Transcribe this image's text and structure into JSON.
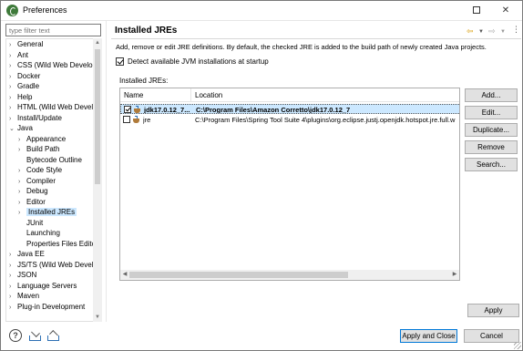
{
  "window": {
    "title": "Preferences",
    "maximize_icon": "maximize-icon",
    "close_label": "✕"
  },
  "filter": {
    "placeholder": "type filter text"
  },
  "nav": {
    "items": [
      {
        "label": "General",
        "chev": ">",
        "depth": 0
      },
      {
        "label": "Ant",
        "chev": ">",
        "depth": 0
      },
      {
        "label": "CSS (Wild Web Developer)",
        "chev": ">",
        "depth": 0
      },
      {
        "label": "Docker",
        "chev": ">",
        "depth": 0
      },
      {
        "label": "Gradle",
        "chev": ">",
        "depth": 0
      },
      {
        "label": "Help",
        "chev": ">",
        "depth": 0
      },
      {
        "label": "HTML (Wild Web Developer)",
        "chev": ">",
        "depth": 0
      },
      {
        "label": "Install/Update",
        "chev": ">",
        "depth": 0
      },
      {
        "label": "Java",
        "chev": "v",
        "depth": 0
      },
      {
        "label": "Appearance",
        "chev": ">",
        "depth": 1
      },
      {
        "label": "Build Path",
        "chev": ">",
        "depth": 1
      },
      {
        "label": "Bytecode Outline",
        "chev": "",
        "depth": 1
      },
      {
        "label": "Code Style",
        "chev": ">",
        "depth": 1
      },
      {
        "label": "Compiler",
        "chev": ">",
        "depth": 1
      },
      {
        "label": "Debug",
        "chev": ">",
        "depth": 1
      },
      {
        "label": "Editor",
        "chev": ">",
        "depth": 1
      },
      {
        "label": "Installed JREs",
        "chev": ">",
        "depth": 1,
        "selected": true
      },
      {
        "label": "JUnit",
        "chev": "",
        "depth": 1
      },
      {
        "label": "Launching",
        "chev": "",
        "depth": 1
      },
      {
        "label": "Properties Files Editor",
        "chev": "",
        "depth": 1
      },
      {
        "label": "Java EE",
        "chev": ">",
        "depth": 0
      },
      {
        "label": "JS/TS (Wild Web Developer)",
        "chev": ">",
        "depth": 0
      },
      {
        "label": "JSON",
        "chev": ">",
        "depth": 0
      },
      {
        "label": "Language Servers",
        "chev": ">",
        "depth": 0
      },
      {
        "label": "Maven",
        "chev": ">",
        "depth": 0
      },
      {
        "label": "Plug-in Development",
        "chev": ">",
        "depth": 0
      }
    ]
  },
  "page": {
    "title": "Installed JREs",
    "description": "Add, remove or edit JRE definitions. By default, the checked JRE is added to the build path of newly created Java projects.",
    "detect_label": "Detect available JVM installations at startup",
    "detect_checked": true,
    "jre_list_label": "Installed JREs:",
    "columns": [
      "Name",
      "Location"
    ],
    "rows": [
      {
        "name": "jdk17.0.12_7...",
        "location": "C:\\Program Files\\Amazon Corretto\\jdk17.0.12_7",
        "checked": true,
        "selected": true
      },
      {
        "name": "jre",
        "location": "C:\\Program Files\\Spring Tool Suite 4\\plugins\\org.eclipse.justj.openjdk.hotspot.jre.full.w",
        "checked": false,
        "selected": false
      }
    ]
  },
  "buttons": {
    "add": "Add...",
    "edit": "Edit...",
    "duplicate": "Duplicate...",
    "remove": "Remove",
    "search": "Search...",
    "apply": "Apply",
    "apply_and_close": "Apply and Close",
    "cancel": "Cancel"
  },
  "icons": {
    "help": "help-icon",
    "import": "import-icon",
    "export": "export-icon",
    "back": "back-arrow-icon",
    "forward": "forward-arrow-icon",
    "view_menu": "view-menu-icon"
  },
  "colors": {
    "selection": "#cce8ff",
    "default_button_border": "#0078d7",
    "history_arrow": "#d99a00"
  }
}
